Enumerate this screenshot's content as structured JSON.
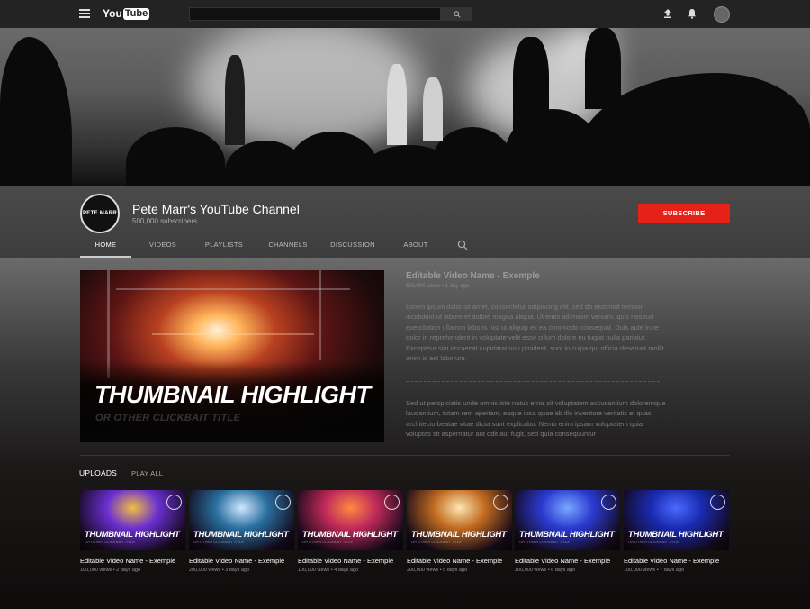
{
  "header": {
    "logo_text": "You",
    "logo_tube": "Tube",
    "search_placeholder": ""
  },
  "channel": {
    "name": "Pete Marr's YouTube Channel",
    "subscribers": "500,000 subscribers",
    "avatar_text": "PETE MARR",
    "subscribe_label": "SUBSCRIBE"
  },
  "tabs": [
    {
      "label": "HOME",
      "active": true
    },
    {
      "label": "VIDEOS"
    },
    {
      "label": "PLAYLISTS"
    },
    {
      "label": "CHANNELS"
    },
    {
      "label": "DISCUSSION"
    },
    {
      "label": "ABOUT"
    }
  ],
  "featured": {
    "thumb_title": "THUMBNAIL HIGHLIGHT",
    "thumb_subtitle": "OR OTHER CLICKBAIT TITLE",
    "title": "Editable Video Name - Exemple",
    "meta": "500,000 views • 1 day ago",
    "description1": "Lorem ipsum dolor sit amet, consectetur adipiscing elit, sed do eiusmod tempor incididunt ut labore et dolore magna aliqua. Ut enim ad minim veniam, quis nostrud exercitation ullamco laboris nisi ut aliquip ex ea commodo consequat. Duis aute irure dolor in reprehenderit in voluptate velit esse cillum dolore eu fugiat nulla pariatur. Excepteur sint occaecat cupidatat non proident, sunt in culpa qui officia deserunt mollit anim id est laborum.",
    "description2": "Sed ut perspiciatis unde omnis iste natus error sit voluptatem accusantium doloremque laudantium, totam rem aperiam, eaque ipsa quae ab illo inventore veritatis et quasi architecto beatae vitae dicta sunt explicabo. Nemo enim ipsam voluptatem quia voluptas sit aspernatur aut odit aut fugit, sed quia consequuntur"
  },
  "uploads": {
    "label": "UPLOADS",
    "play_all": "PLAY ALL",
    "videos": [
      {
        "thumb_title": "THUMBNAIL HIGHLIGHT",
        "thumb_subtitle": "OR OTHER CLICKBAIT TITLE",
        "name": "Editable Video Name - Exemple",
        "meta": "100,000 views • 2 days ago",
        "color1": "#6a2fd0",
        "color2": "#f0c040"
      },
      {
        "thumb_title": "THUMBNAIL HIGHLIGHT",
        "thumb_subtitle": "OR OTHER CLICKBAIT TITLE",
        "name": "Editable Video Name - Exemple",
        "meta": "200,000 views • 3 days ago",
        "color1": "#2a6fa0",
        "color2": "#d0e8ff"
      },
      {
        "thumb_title": "THUMBNAIL HIGHLIGHT",
        "thumb_subtitle": "OR OTHER CLICKBAIT TITLE",
        "name": "Editable Video Name - Exemple",
        "meta": "100,000 views • 4 days ago",
        "color1": "#c02a5a",
        "color2": "#ff8a40"
      },
      {
        "thumb_title": "THUMBNAIL HIGHLIGHT",
        "thumb_subtitle": "OR OTHER CLICKBAIT TITLE",
        "name": "Editable Video Name - Exemple",
        "meta": "200,000 views • 5 days ago",
        "color1": "#c06a20",
        "color2": "#ffe6b0"
      },
      {
        "thumb_title": "THUMBNAIL HIGHLIGHT",
        "thumb_subtitle": "OR OTHER CLICKBAIT TITLE",
        "name": "Editable Video Name - Exemple",
        "meta": "100,000 views • 6 days ago",
        "color1": "#2a3ad0",
        "color2": "#7aa8ff"
      },
      {
        "thumb_title": "THUMBNAIL HIGHLIGHT",
        "thumb_subtitle": "OR OTHER CLICKBAIT TITLE",
        "name": "Editable Video Name - Exemple",
        "meta": "100,000 views • 7 days ago",
        "color1": "#1a2ab0",
        "color2": "#4a6aff"
      }
    ]
  }
}
